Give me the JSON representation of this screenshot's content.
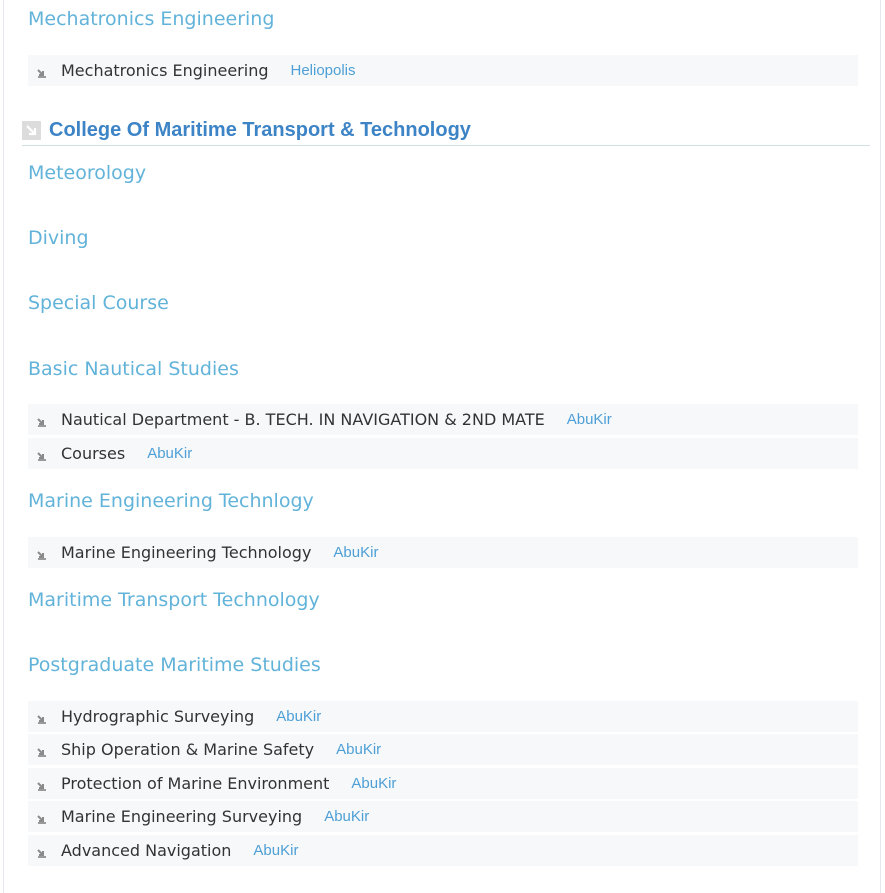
{
  "sections": {
    "mechatronics": {
      "title": "Mechatronics Engineering",
      "programs": [
        {
          "name": "Mechatronics Engineering",
          "campus": "Heliopolis"
        }
      ]
    },
    "college": {
      "title": "College Of Maritime Transport & Technology"
    },
    "meteorology": {
      "title": "Meteorology"
    },
    "diving": {
      "title": "Diving"
    },
    "special_course": {
      "title": "Special Course"
    },
    "basic_nautical": {
      "title": "Basic Nautical Studies",
      "programs": [
        {
          "name": "Nautical Department - B. TECH. IN NAVIGATION & 2ND MATE",
          "campus": "AbuKir"
        },
        {
          "name": "Courses",
          "campus": "AbuKir"
        }
      ]
    },
    "marine_engineering": {
      "title": "Marine Engineering Technlogy",
      "programs": [
        {
          "name": "Marine Engineering Technology",
          "campus": "AbuKir"
        }
      ]
    },
    "maritime_transport": {
      "title": "Maritime Transport Technology"
    },
    "postgraduate": {
      "title": "Postgraduate Maritime Studies",
      "programs": [
        {
          "name": "Hydrographic Surveying",
          "campus": "AbuKir"
        },
        {
          "name": "Ship Operation & Marine Safety",
          "campus": "AbuKir"
        },
        {
          "name": "Protection of Marine Environment",
          "campus": "AbuKir"
        },
        {
          "name": "Marine Engineering Surveying",
          "campus": "AbuKir"
        },
        {
          "name": "Advanced Navigation",
          "campus": "AbuKir"
        }
      ]
    }
  },
  "icons": {
    "program_row": "arrow-down-right-icon",
    "college_header": "arrow-down-right-box-icon"
  },
  "colors": {
    "department_title": "#62b3d9",
    "college_title": "#3d84c6",
    "campus_link": "#4d9fd6",
    "program_text": "#333333",
    "row_background": "#f6f8fa"
  }
}
